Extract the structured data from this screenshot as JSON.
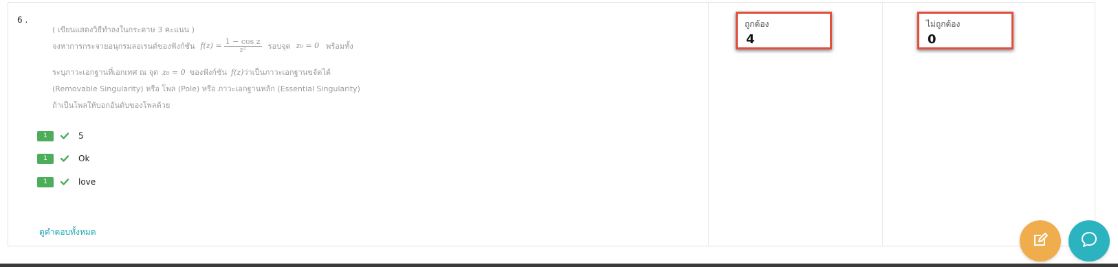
{
  "question": {
    "number": "6 .",
    "lines": [
      "( เขียนแสดงวิธีทำลงในกระดาษ 3 คะแนน )",
      "จงหาการกระจายอนุกรมลอเรนต์ของฟังก์ชัน",
      "รอบจุด",
      "พร้อมทั้ง",
      "ระบุภาวะเอกฐานที่เอกเทศ ณ จุด",
      "ของฟังก์ชัน",
      "ว่าเป็นภาวะเอกฐานขจัดได้",
      "(Removable Singularity) หรือ โพล (Pole) หรือ ภาวะเอกฐานหลัก (Essential Singularity)",
      "ถ้าเป็นโพลให้บอกอันดับของโพลด้วย"
    ],
    "math": {
      "fz": "f(z) =",
      "numerator": "1 − cos z",
      "denominator": "z²",
      "z0": "z₀ = 0",
      "fz_short": "f(z)"
    }
  },
  "answers": [
    {
      "badge": "1",
      "text": "5"
    },
    {
      "badge": "1",
      "text": "Ok"
    },
    {
      "badge": "1",
      "text": "love"
    }
  ],
  "see_all_label": "ดูคำตอบทั้งหมด",
  "stats": {
    "correct_label": "ถูกต้อง",
    "correct_value": "4",
    "incorrect_label": "ไม่ถูกต้อง",
    "incorrect_value": "0"
  },
  "colors": {
    "badge_green": "#4cae5b",
    "highlight_red": "#e0503b",
    "link_teal": "#1aa6b6",
    "fab_orange": "#f0ad4e",
    "fab_teal": "#2bb3c0"
  },
  "icons": {
    "check": "check-icon",
    "edit": "edit-icon",
    "chat": "chat-icon"
  }
}
